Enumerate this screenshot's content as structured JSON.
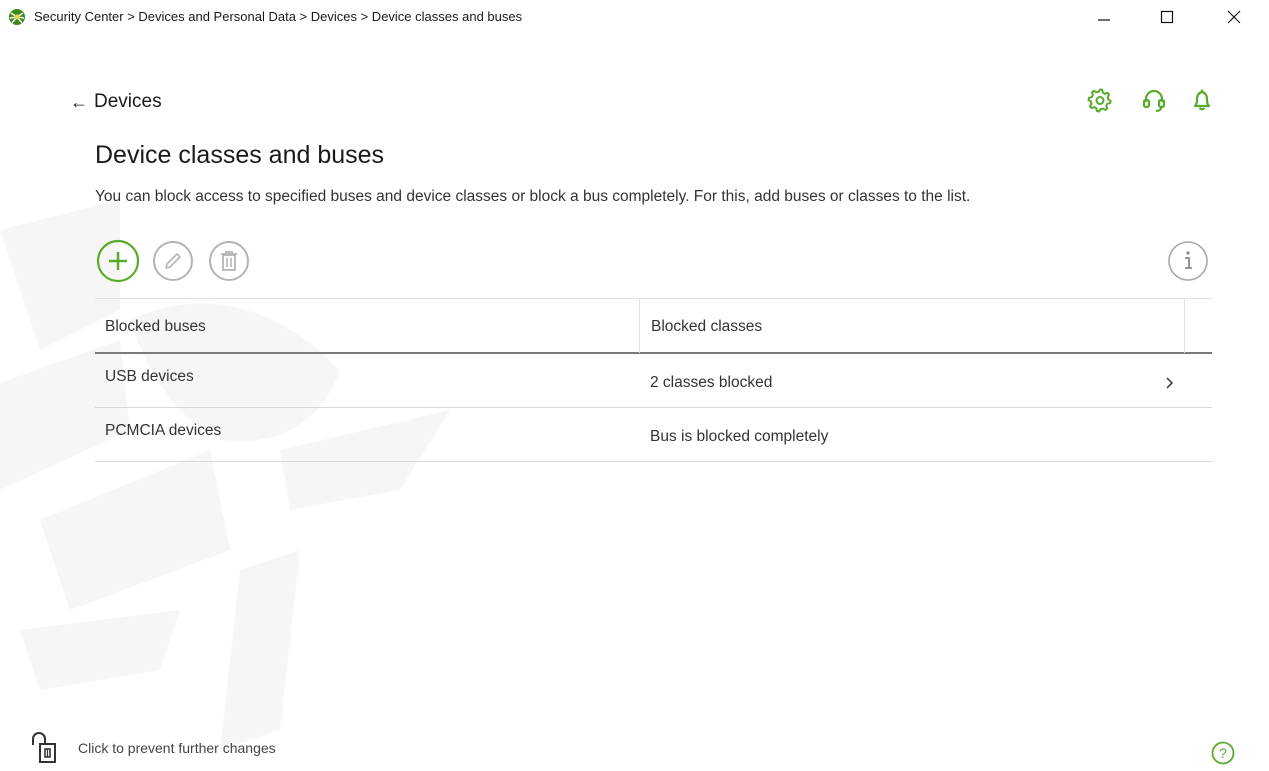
{
  "window": {
    "title": "Security Center > Devices and Personal Data > Devices > Device classes and buses",
    "app_icon": "spider-logo-icon",
    "controls": [
      "minimize-icon",
      "maximize-icon",
      "close-icon"
    ]
  },
  "header": {
    "back_arrow": "←",
    "back_label": "Devices",
    "icons": [
      "gear-icon",
      "headset-icon",
      "bell-icon"
    ]
  },
  "main": {
    "title": "Device classes and buses",
    "description": "You can block access to specified buses and device classes or block a bus completely. For this, add buses or classes to the list."
  },
  "toolbar": {
    "buttons": [
      "add-icon",
      "edit-icon",
      "delete-icon",
      "info-icon"
    ]
  },
  "table": {
    "columns": [
      "Blocked buses",
      "Blocked classes"
    ],
    "rows": [
      {
        "bus": "USB devices",
        "classes": "2 classes blocked",
        "expandable": true
      },
      {
        "bus": "PCMCIA devices",
        "classes": "Bus is blocked completely",
        "expandable": false
      }
    ]
  },
  "footer": {
    "lock_label": "Click to prevent further changes",
    "help_symbol": "?"
  },
  "colors": {
    "accent": "#5aaa2c",
    "disabled": "#b4b4b4",
    "text": "#333333"
  }
}
